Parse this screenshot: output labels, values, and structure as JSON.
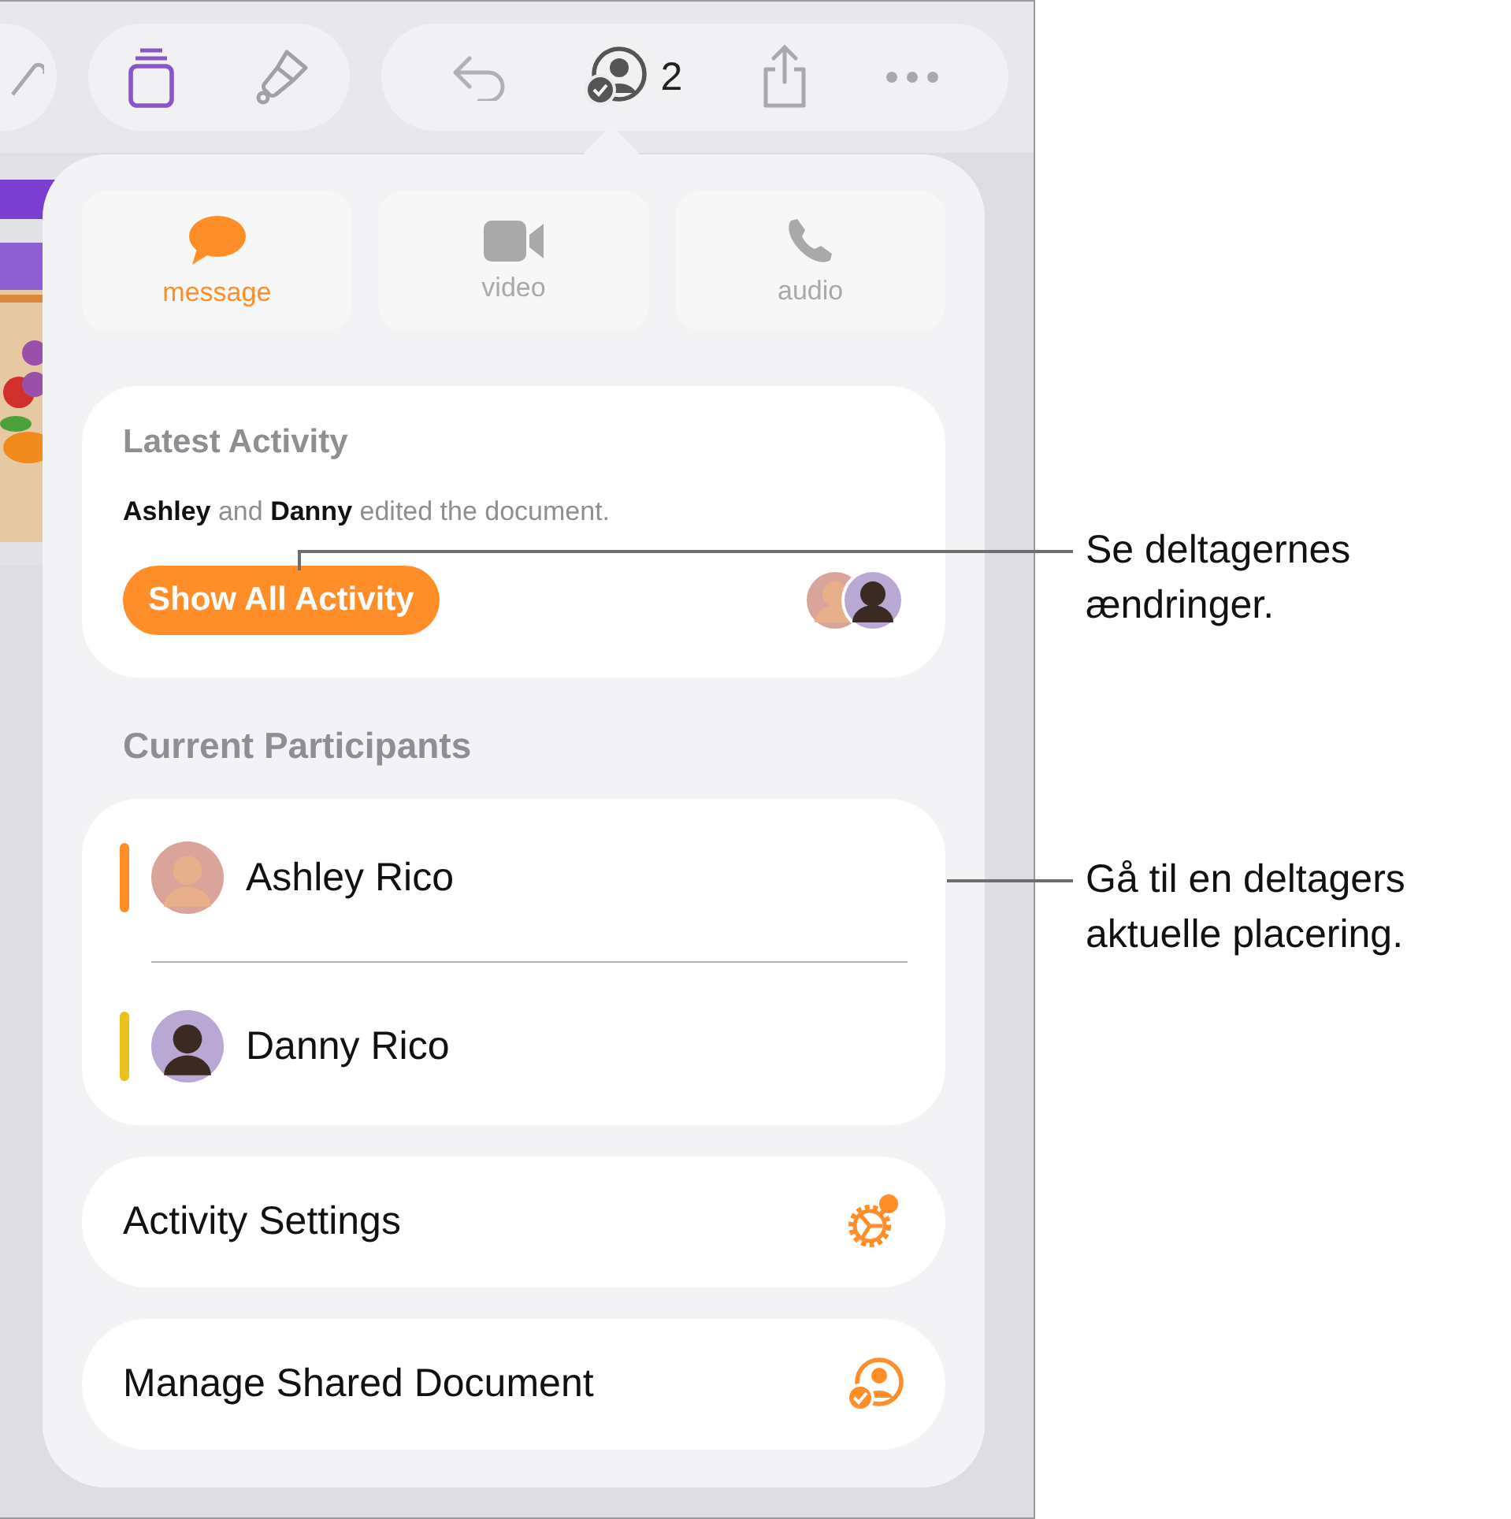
{
  "toolbar": {
    "participant_count": "2"
  },
  "contact_options": [
    {
      "label": "message",
      "kind": "message",
      "disabled": false
    },
    {
      "label": "video",
      "kind": "video",
      "disabled": true
    },
    {
      "label": "audio",
      "kind": "audio",
      "disabled": true
    }
  ],
  "latest_activity": {
    "title": "Latest Activity",
    "summary": "**Ashley** and **Danny** edited the document.",
    "button": "Show All Activity"
  },
  "participants": {
    "title": "Current Participants",
    "items": [
      {
        "name": "Ashley Rico",
        "color": "#ff8d28"
      },
      {
        "name": "Danny Rico",
        "color": "#e8c21c"
      }
    ]
  },
  "actions": [
    {
      "label": "Activity Settings",
      "kind": "settings"
    },
    {
      "label": "Manage Shared Document",
      "kind": "manage"
    }
  ],
  "callouts": [
    {
      "text": "Se deltagernes\nændringer."
    },
    {
      "text": "Gå til en deltagers\naktuelle placering."
    }
  ]
}
